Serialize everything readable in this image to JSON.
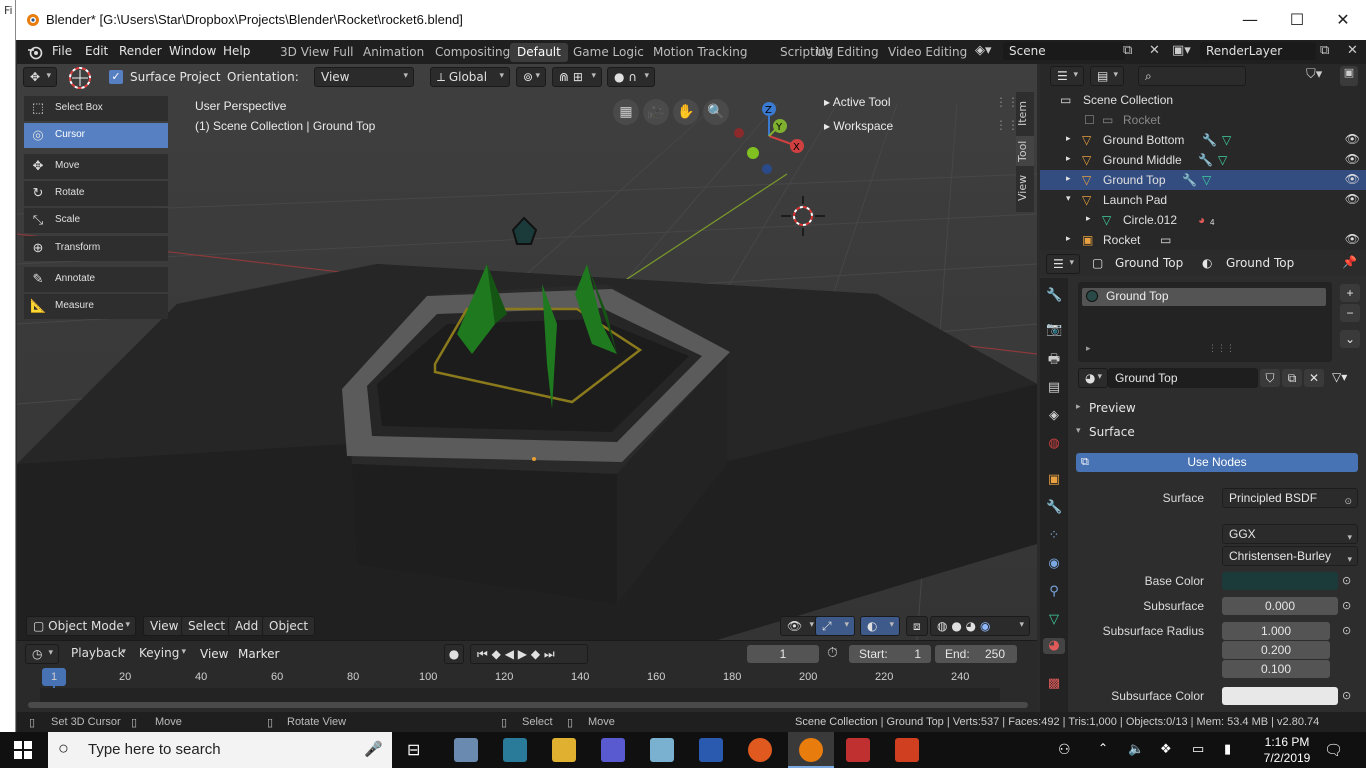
{
  "window": {
    "title": "Blender* [G:\\Users\\Star\\Dropbox\\Projects\\Blender\\Rocket\\rocket6.blend]",
    "left_strip_label": "Fi"
  },
  "menubar": {
    "items": [
      "File",
      "Edit",
      "Render",
      "Window",
      "Help"
    ],
    "workspaces": [
      "3D View Full",
      "Animation",
      "Compositing",
      "Default",
      "Game Logic",
      "Motion Tracking",
      "Scripting",
      "UV Editing",
      "Video Editing"
    ],
    "active_workspace": "Default",
    "scene": "Scene",
    "view_layer": "RenderLayer"
  },
  "viewport_header": {
    "surface_project_label": "Surface Project",
    "surface_project_checked": true,
    "orientation_label": "Orientation:",
    "orientation_value": "View",
    "transform_orientation": "Global"
  },
  "toolbar": {
    "tools": [
      {
        "label": "Select Box",
        "icon": "select-box-icon"
      },
      {
        "label": "Cursor",
        "icon": "cursor-icon",
        "active": true
      },
      {
        "label": "Move",
        "icon": "move-icon"
      },
      {
        "label": "Rotate",
        "icon": "rotate-icon"
      },
      {
        "label": "Scale",
        "icon": "scale-icon"
      },
      {
        "label": "Transform",
        "icon": "transform-icon"
      },
      {
        "label": "Annotate",
        "icon": "annotate-icon"
      },
      {
        "label": "Measure",
        "icon": "measure-icon"
      }
    ]
  },
  "viewport_overlay": {
    "perspective": "User Perspective",
    "collection_info": "(1) Scene Collection | Ground Top",
    "active_tool_label": "Active Tool",
    "workspace_label": "Workspace",
    "side_tabs": [
      "Item",
      "Tool",
      "View"
    ]
  },
  "viewport_footer": {
    "mode": "Object Mode",
    "menus": [
      "View",
      "Select",
      "Add",
      "Object"
    ]
  },
  "timeline": {
    "menus": [
      "Playback",
      "Keying",
      "View",
      "Marker"
    ],
    "current_frame": "1",
    "start_label": "Start:",
    "start": "1",
    "end_label": "End:",
    "end": "250",
    "ruler": [
      "1",
      "20",
      "40",
      "60",
      "80",
      "100",
      "120",
      "140",
      "160",
      "180",
      "200",
      "220",
      "240"
    ]
  },
  "statusbar": {
    "hints": [
      "Set 3D Cursor",
      "Move",
      "Rotate View",
      "Select",
      "Move"
    ],
    "info": "Scene Collection | Ground Top | Verts:537 | Faces:492 | Tris:1,000 | Objects:0/13 | Mem: 53.4 MB | v2.80.74"
  },
  "outliner": {
    "rows": [
      {
        "label": "Scene Collection"
      },
      {
        "label": "Rocket"
      },
      {
        "label": "Ground Bottom"
      },
      {
        "label": "Ground Middle"
      },
      {
        "label": "Ground Top",
        "selected": true
      },
      {
        "label": "Launch Pad"
      },
      {
        "label": "Circle.012",
        "badge": "4"
      },
      {
        "label": "Rocket"
      }
    ]
  },
  "properties": {
    "header_object": "Ground Top",
    "header_material": "Ground Top",
    "material_slot": "Ground Top",
    "material_name": "Ground Top",
    "preview_label": "Preview",
    "surface_section_label": "Surface",
    "use_nodes_label": "Use Nodes",
    "surface_label": "Surface",
    "surface_value": "Principled BSDF",
    "distribution": "GGX",
    "subsurface_method": "Christensen-Burley",
    "base_color_label": "Base Color",
    "base_color": "#1b3a3a",
    "subsurface_label": "Subsurface",
    "subsurface_value": "0.000",
    "subsurface_radius_label": "Subsurface Radius",
    "subsurface_radius": [
      "1.000",
      "0.200",
      "0.100"
    ],
    "subsurface_color_label": "Subsurface Color",
    "subsurface_color": "#e8e8e8"
  },
  "taskbar": {
    "search_placeholder": "Type here to search",
    "time": "1:16 PM",
    "date": "7/2/2019"
  },
  "colors": {
    "accent": "#5680c2",
    "selected_row": "#334d80",
    "blender_orange": "#e87d0d"
  }
}
